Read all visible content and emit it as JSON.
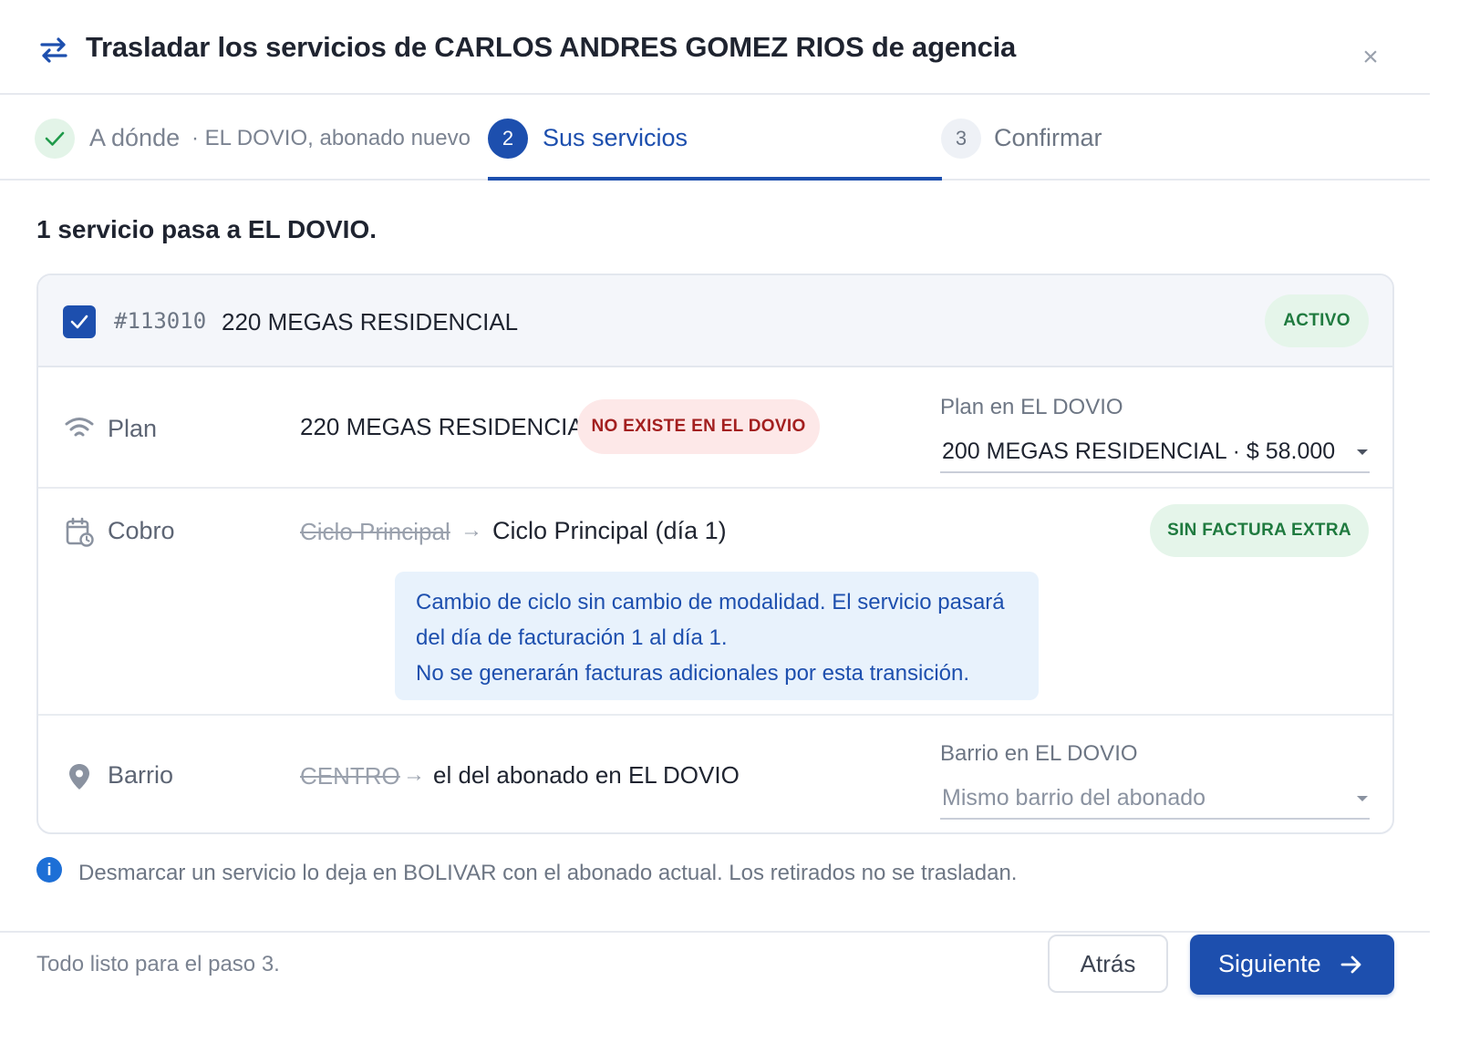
{
  "header": {
    "title": "Trasladar los servicios de CARLOS ANDRES GOMEZ RIOS de agencia",
    "icon": "swap-arrows-icon",
    "close_label": "×"
  },
  "steps": [
    {
      "number": "1",
      "label": "A dónde",
      "detail": "· EL DOVIO, abonado nuevo",
      "state": "done"
    },
    {
      "number": "2",
      "label": "Sus servicios",
      "state": "active"
    },
    {
      "number": "3",
      "label": "Confirmar",
      "state": "pending"
    }
  ],
  "summary": "1 servicio pasa a EL DOVIO.",
  "service": {
    "checked": true,
    "id": "#113010",
    "name": "220 MEGAS RESIDENCIAL",
    "status": "ACTIVO",
    "plan": {
      "label": "Plan",
      "current": "220 MEGAS RESIDENCIAL",
      "badge": "NO EXISTE EN EL DOVIO",
      "select_label": "Plan en EL DOVIO",
      "select_value": "200 MEGAS RESIDENCIAL · $ 58.000"
    },
    "cobro": {
      "label": "Cobro",
      "old": "Ciclo Principal",
      "arrow": "→",
      "new": "Ciclo Principal (día 1)",
      "badge": "SIN FACTURA EXTRA",
      "info_line1": "Cambio de ciclo sin cambio de modalidad. El servicio pasará",
      "info_line2": "del día de facturación 1 al día 1.",
      "info_line3": "No se generarán facturas adicionales por esta transición."
    },
    "barrio": {
      "label": "Barrio",
      "old": "CENTRO",
      "arrow": "→",
      "new": "el del abonado en EL DOVIO",
      "select_label": "Barrio en EL DOVIO",
      "select_placeholder": "Mismo barrio del abonado"
    }
  },
  "footnote": "Desmarcar un servicio lo deja en BOLIVAR con el abonado actual. Los retirados no se trasladan.",
  "footer": {
    "status": "Todo listo para el paso 3.",
    "back_label": "Atrás",
    "next_label": "Siguiente"
  },
  "colors": {
    "primary": "#1d4fae",
    "success_bg": "#e5f5ea",
    "success_text": "#1f7a3f",
    "danger_bg": "#fde8e8",
    "danger_text": "#a31f1f",
    "info_bg": "#e8f2fc"
  }
}
